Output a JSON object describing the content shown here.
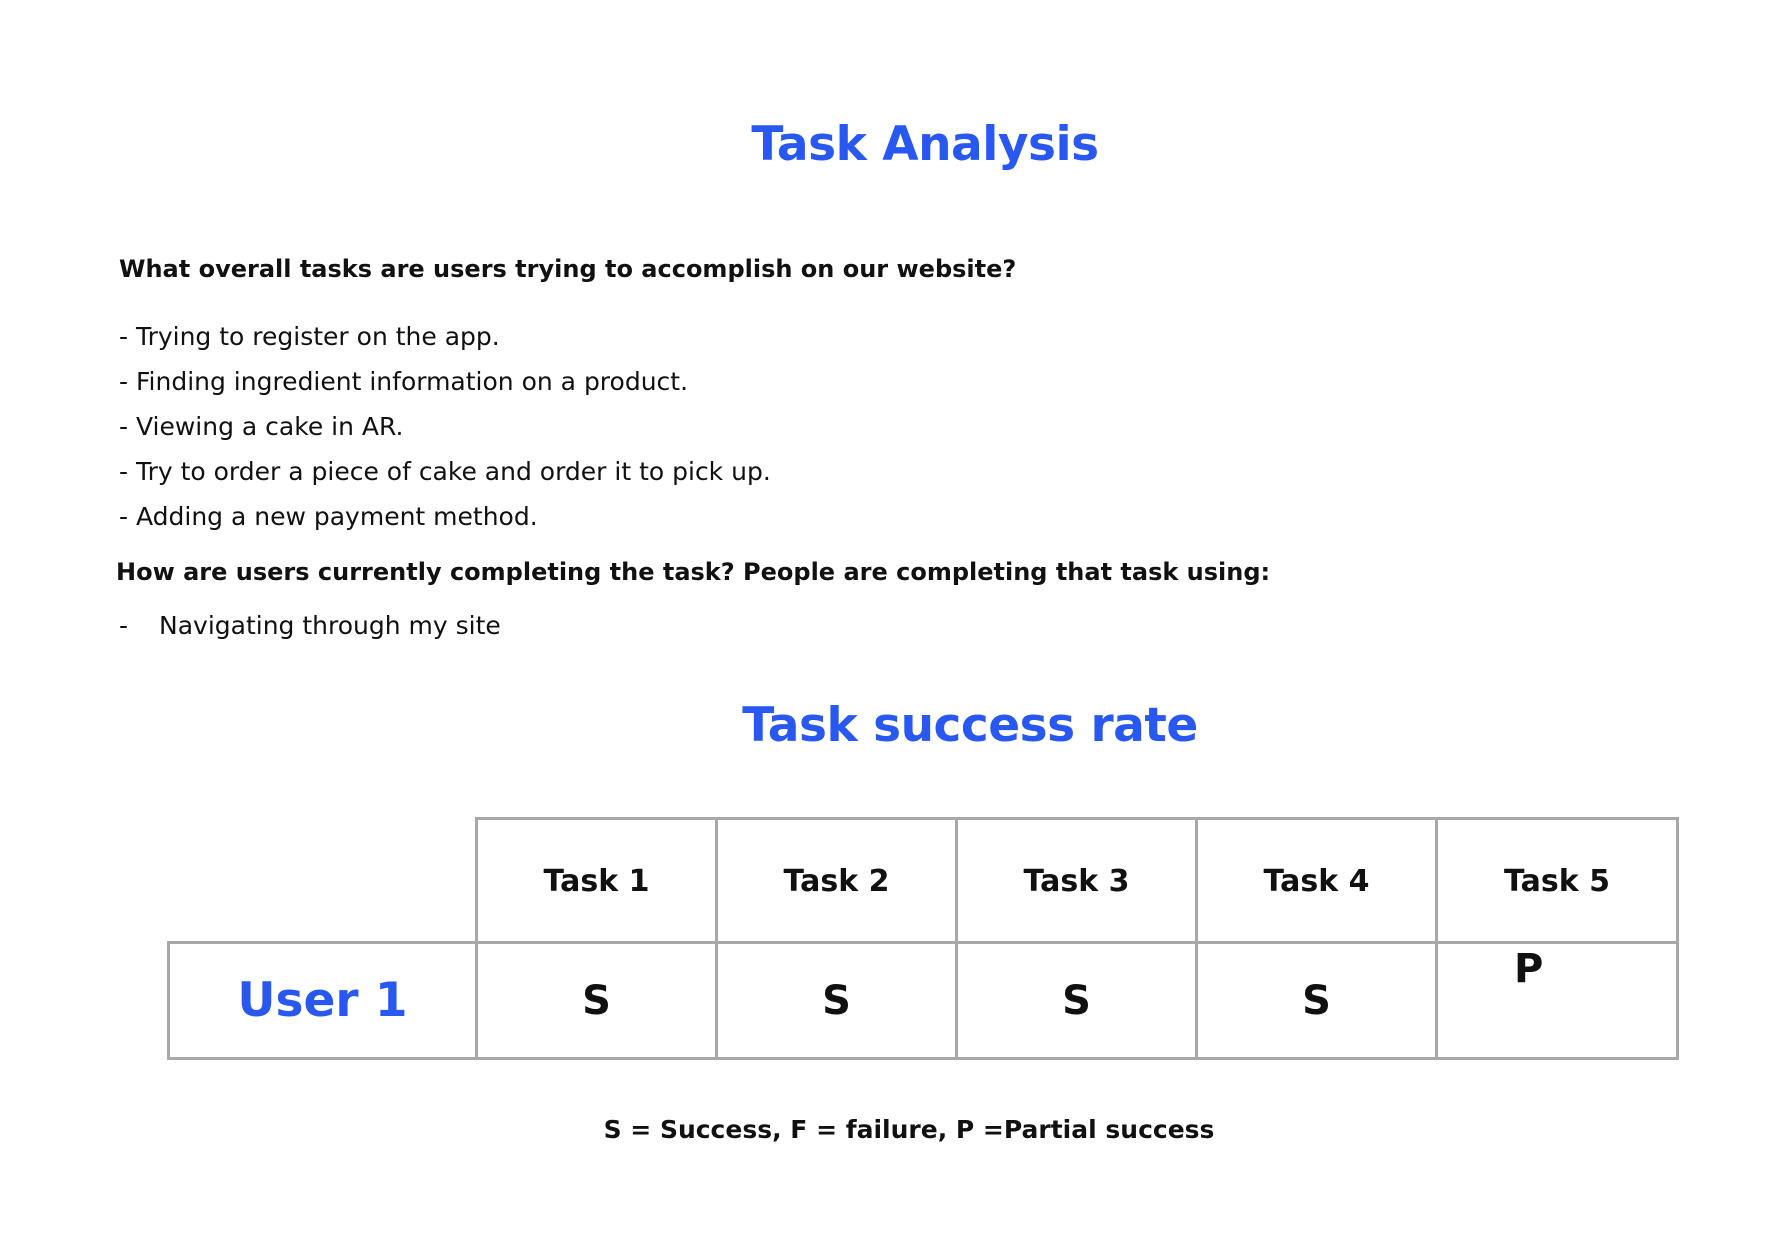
{
  "document": {
    "title": "Task Analysis",
    "question_tasks": "What overall tasks are users trying to accomplish on our website?",
    "tasks": [
      "- Trying to register on the app.",
      "- Finding ingredient information on a product.",
      "- Viewing a cake in AR.",
      "- Try to order a piece of cake and order it to pick up.",
      "- Adding a new payment method."
    ],
    "question_methods": "How are users currently completing the task? People are completing that task using:",
    "methods": [
      {
        "bullet": "-",
        "text": "Navigating through my site"
      }
    ]
  },
  "success_table": {
    "title": "Task success rate",
    "columns": [
      "Task 1",
      "Task 2",
      "Task 3",
      "Task 4",
      "Task 5"
    ],
    "rows": [
      {
        "label": "User 1",
        "results": [
          "S",
          "S",
          "S",
          "S",
          "P"
        ]
      }
    ],
    "legend": "S = Success, F = failure, P =Partial success"
  },
  "colors": {
    "accent": "#2858f0",
    "text": "#111111",
    "table_border": "#a8a8a8"
  }
}
